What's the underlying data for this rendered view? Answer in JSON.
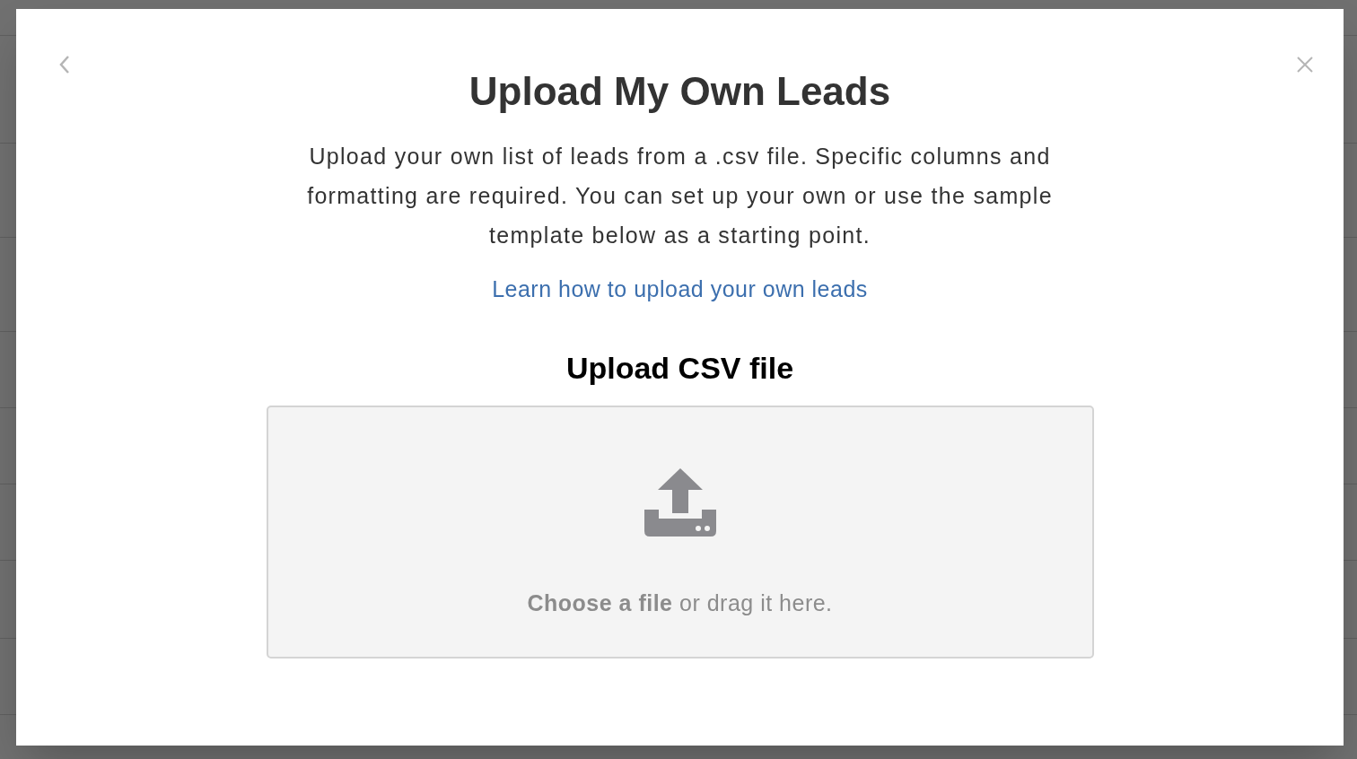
{
  "modal": {
    "title": "Upload My Own Leads",
    "description": "Upload your own list of leads from a .csv file. Specific columns and formatting are required. You can set up your own or use the sample template below as a starting point.",
    "help_link": "Learn how to upload your own leads",
    "section_title": "Upload CSV file",
    "dropzone": {
      "prompt": "**Choose a file** or drag it here."
    }
  }
}
